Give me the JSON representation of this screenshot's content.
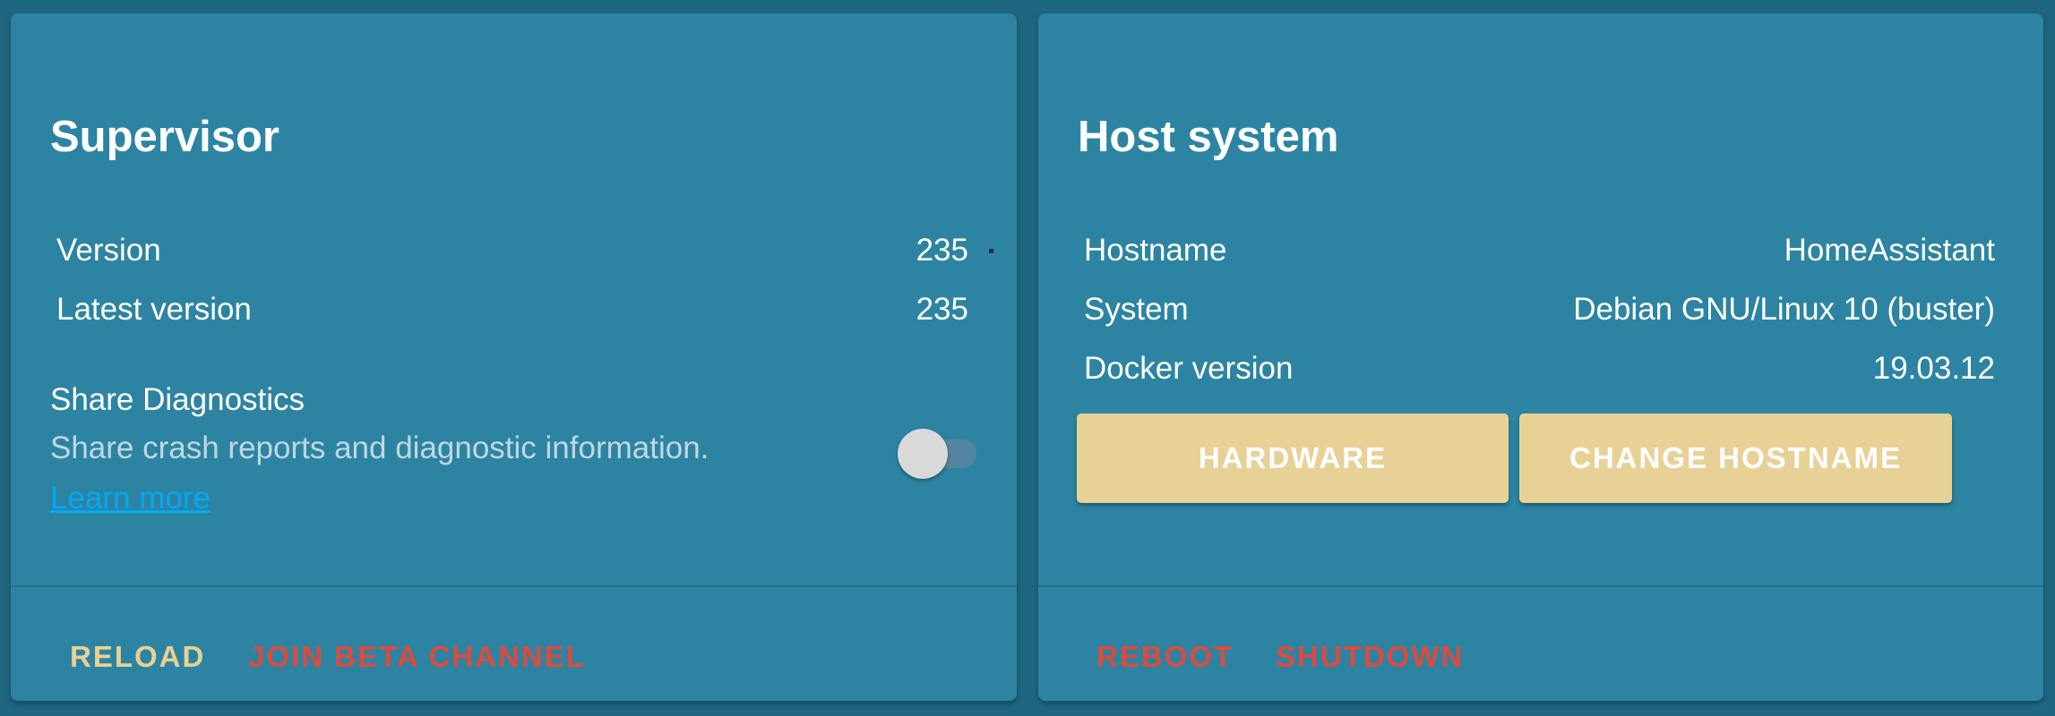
{
  "supervisor": {
    "title": "Supervisor",
    "rows": [
      {
        "label": "Version",
        "value": "235"
      },
      {
        "label": "Latest version",
        "value": "235"
      }
    ],
    "diagnostics": {
      "title": "Share Diagnostics",
      "description": "Share crash reports and diagnostic information.",
      "link": "Learn more",
      "enabled": false
    },
    "actions": {
      "reload": "RELOAD",
      "join_beta": "JOIN BETA CHANNEL"
    }
  },
  "host": {
    "title": "Host system",
    "rows": [
      {
        "label": "Hostname",
        "value": "HomeAssistant"
      },
      {
        "label": "System",
        "value": "Debian GNU/Linux 10 (buster)"
      },
      {
        "label": "Docker version",
        "value": "19.03.12"
      }
    ],
    "buttons": {
      "hardware": "HARDWARE",
      "change_hostname": "CHANGE HOSTNAME"
    },
    "actions": {
      "reboot": "REBOOT",
      "shutdown": "SHUTDOWN"
    }
  },
  "colors": {
    "background": "#1f6680",
    "card": "#2c84a2",
    "primary_button": "#e8d196",
    "warning_action": "#db4b3e",
    "link": "#03a9f4"
  }
}
